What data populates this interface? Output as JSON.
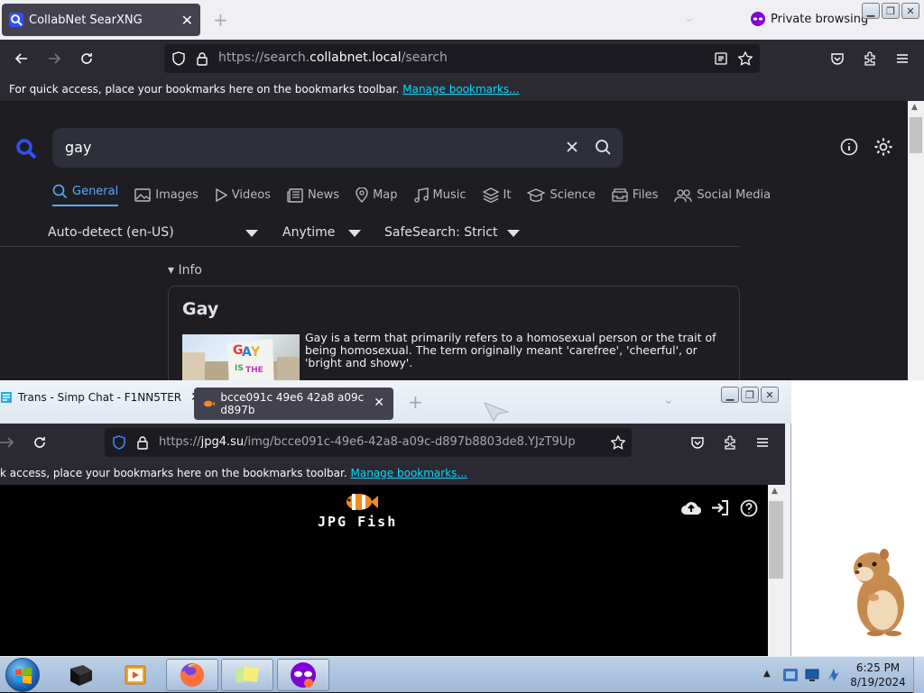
{
  "browser1": {
    "tab": {
      "title": "CollabNet SearXNG"
    },
    "private_label": "Private browsing",
    "url": {
      "prefix": "https://search.",
      "domain": "collabnet.local",
      "path": "/search"
    },
    "bookmarks_bar": {
      "text": "For quick access, place your bookmarks here on the bookmarks toolbar.",
      "link": "Manage bookmarks..."
    },
    "search": {
      "query": "gay"
    },
    "categories": [
      "General",
      "Images",
      "Videos",
      "News",
      "Map",
      "Music",
      "It",
      "Science",
      "Files",
      "Social Media"
    ],
    "active_category": "General",
    "filters": {
      "language": "Auto-detect (en-US)",
      "time": "Anytime",
      "safesearch": "SafeSearch: Strict"
    },
    "info_toggle": "▾ Info",
    "infobox": {
      "title": "Gay",
      "text": "Gay is a term that primarily refers to a homosexual person or the trait of being homosexual. The term originally meant 'carefree', 'cheerful', or 'bright and showy'."
    }
  },
  "browser2": {
    "tabs": [
      {
        "title": "Trans - Simp Chat - F1NN5TER"
      },
      {
        "title": "bcce091c 49e6 42a8 a09c d897b"
      }
    ],
    "url": {
      "prefix": "https://",
      "domain": "jpg4.su",
      "path": "/img/bcce091c-49e6-42a8-a09c-d897b8803de8.YJzT9Up"
    },
    "bookmarks_bar": {
      "text": "k access, place your bookmarks here on the bookmarks toolbar.",
      "link": "Manage bookmarks..."
    },
    "logo_text": "JPG Fish"
  },
  "taskbar": {
    "time": "6:25 PM",
    "date": "8/19/2024"
  },
  "colors": {
    "accent": "#5aa9ff",
    "link": "#00ddff",
    "private": "#8000d7"
  }
}
